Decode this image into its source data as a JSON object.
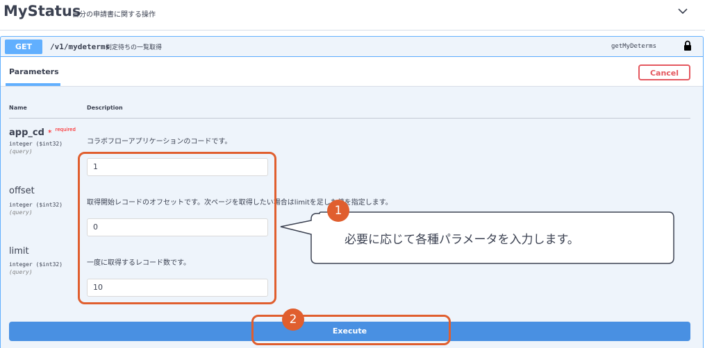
{
  "section": {
    "title": "MyStatus",
    "description": "自分の申請書に関する操作",
    "collapse_icon": "chevron-down-icon"
  },
  "operation": {
    "method": "GET",
    "path": "/v1/mydeterms",
    "summary": "判定待ちの一覧取得",
    "operation_id": "getMyDeterms",
    "lock_icon": "lock-icon"
  },
  "parameters_panel": {
    "tab_label": "Parameters",
    "cancel_label": "Cancel",
    "columns": {
      "name": "Name",
      "description": "Description"
    },
    "params": [
      {
        "name": "app_cd",
        "required_mark": "*",
        "required_label": "required",
        "type": "integer ($int32)",
        "in": "(query)",
        "description": "コラボフローアプリケーションのコードです。",
        "value": "1"
      },
      {
        "name": "offset",
        "type": "integer ($int32)",
        "in": "(query)",
        "description": "取得開始レコードのオフセットです。次ページを取得したい場合はlimitを足した値を指定します。",
        "value": "0"
      },
      {
        "name": "limit",
        "type": "integer ($int32)",
        "in": "(query)",
        "description": "一度に取得するレコード数です。",
        "value": "10"
      }
    ],
    "execute_label": "Execute"
  },
  "annotations": {
    "step1": "1",
    "step2": "2",
    "callout": "必要に応じて各種パラメータを入力します。",
    "color": "#e05e2e"
  },
  "colors": {
    "accent": "#61affe",
    "execute": "#4990e2",
    "cancel": "#e4575e",
    "panel": "#eef4fb"
  }
}
